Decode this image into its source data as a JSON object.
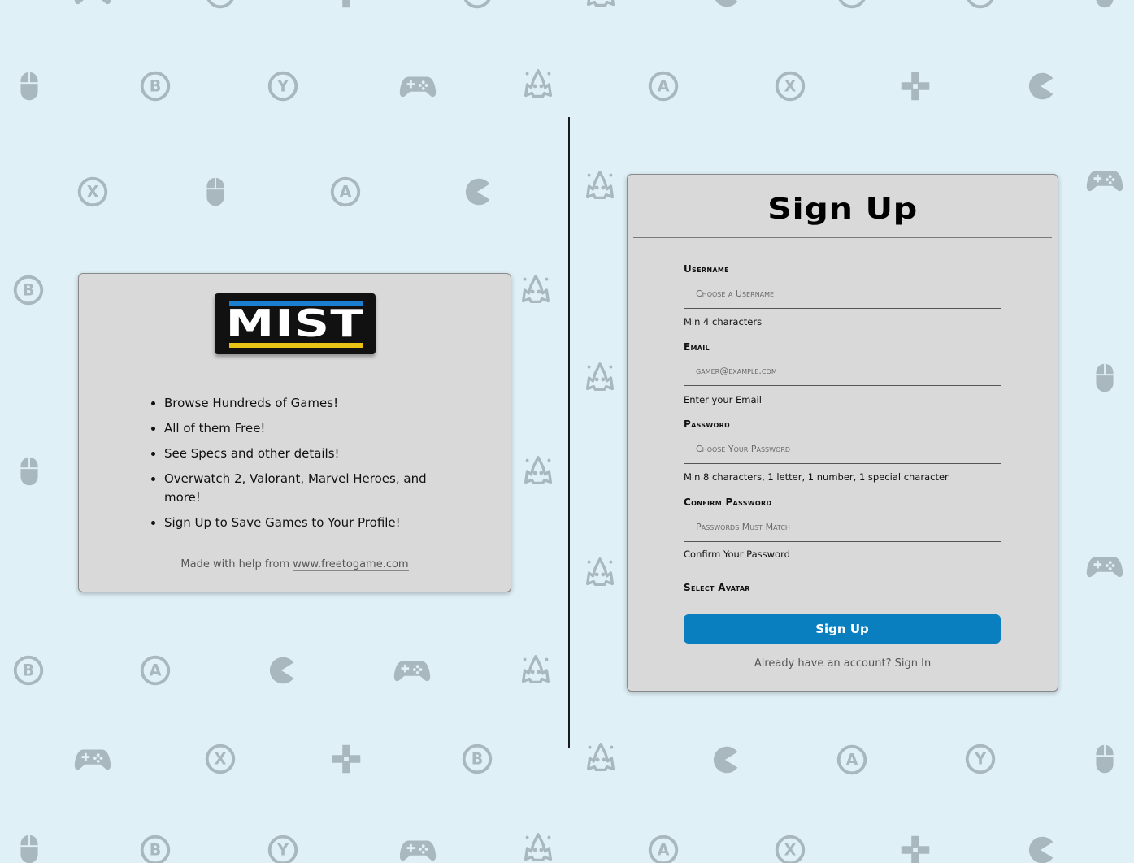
{
  "brand": {
    "logo_text": "MIST",
    "accent_blue": "#1a7fd1",
    "accent_yellow": "#e9c216"
  },
  "info": {
    "features": [
      "Browse Hundreds of Games!",
      "All of them Free!",
      "See Specs and other details!",
      "Overwatch 2, Valorant, Marvel Heroes, and more!",
      "Sign Up to Save Games to Your Profile!"
    ],
    "credit_prefix": "Made with help from",
    "credit_link": "www.freetogame.com"
  },
  "signup": {
    "title": "Sign Up",
    "username": {
      "label": "Username",
      "placeholder": "Choose a Username",
      "hint": "Min 4 characters"
    },
    "email": {
      "label": "Email",
      "placeholder": "gamer@example.com",
      "hint": "Enter your Email"
    },
    "password": {
      "label": "Password",
      "placeholder": "Choose Your Password",
      "hint": "Min 8 characters, 1 letter, 1 number, 1 special character"
    },
    "confirm": {
      "label": "Confirm Password",
      "placeholder": "Passwords Must Match",
      "hint": "Confirm Your Password"
    },
    "avatar_label": "Select Avatar",
    "submit_label": "Sign Up",
    "signin_prompt": "Already have an account?",
    "signin_link": "Sign In",
    "button_color": "#0a7fc0"
  },
  "background": {
    "icon_color": "#a9b7bf",
    "icons": [
      "controller-icon",
      "b-button-icon",
      "y-button-icon",
      "a-button-icon",
      "x-button-icon",
      "dpad-icon",
      "pacman-icon",
      "mouse-icon",
      "invader-icon"
    ]
  }
}
